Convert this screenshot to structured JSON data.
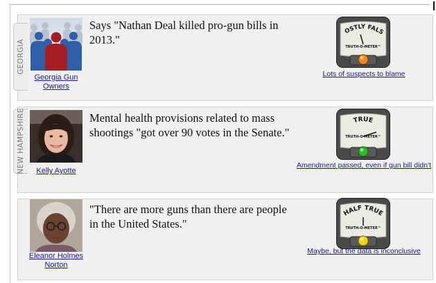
{
  "items": [
    {
      "tab": "GEORGIA",
      "speaker": "Georgia Gun Owners",
      "speaker_icon": "group-silhouette-icon",
      "quote": "Says \"Nathan Deal killed pro-gun bills in 2013.\"",
      "meter_label": "MOSTLY FALSE",
      "meter_sub": "TRUTH-O-METER™",
      "light_color": "#f08a1a",
      "ruling_text": "Lots of suspects to blame"
    },
    {
      "tab": "NEW HAMPSHIRE",
      "speaker": "Kelly Ayotte",
      "quote": "Mental health provisions related to mass shootings \"got over 90 votes in the Senate.\"",
      "meter_label": "TRUE",
      "meter_sub": "TRUTH-O-METER™",
      "light_color": "#2fb82a",
      "ruling_text": "Amendment passed, even if gun bill didn't"
    },
    {
      "tab": "",
      "speaker": "Eleanor Holmes Norton",
      "quote": "\"There are more guns than there are people in the United States.\"",
      "meter_label": "HALF TRUE",
      "meter_sub": "TRUTH-O-METER™",
      "light_color": "#f2d417",
      "ruling_text": "Maybe, but the data is inconclusive"
    }
  ]
}
